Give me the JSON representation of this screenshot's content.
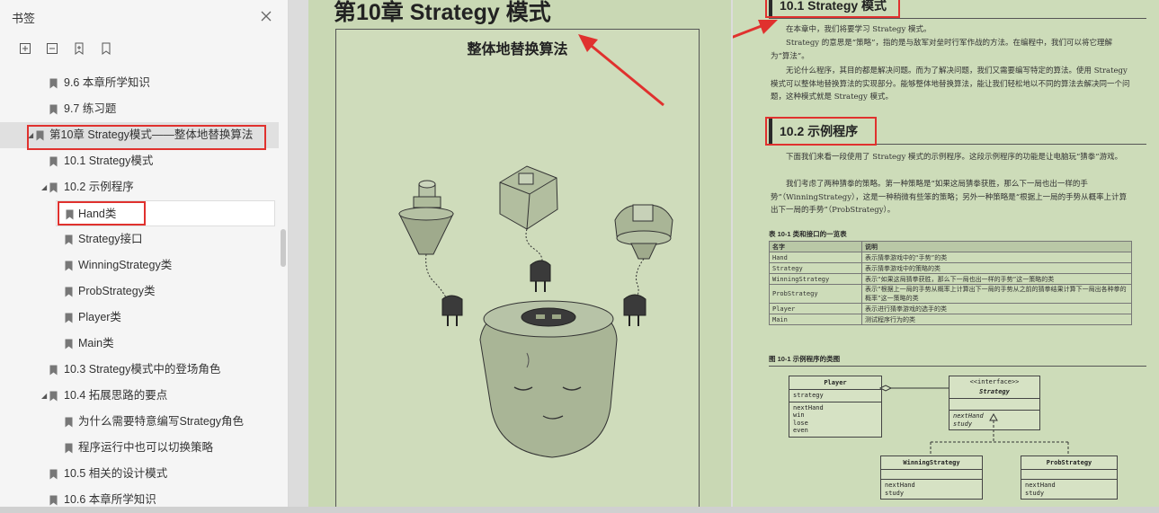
{
  "sidebar": {
    "title": "书签",
    "close_icon": "close-icon",
    "tools": [
      "expand-all-icon",
      "collapse-all-icon",
      "add-bookmark-icon",
      "bookmark-icon"
    ],
    "items": [
      {
        "label": "9.6 本章所学知识"
      },
      {
        "label": "9.7 练习题"
      },
      {
        "label": "第10章 Strategy模式——整体地替换算法",
        "expanded": true
      },
      {
        "label": "10.1 Strategy模式"
      },
      {
        "label": "10.2 示例程序",
        "expanded": true
      },
      {
        "label": "Hand类",
        "selected": true
      },
      {
        "label": "Strategy接口"
      },
      {
        "label": "WinningStrategy类"
      },
      {
        "label": "ProbStrategy类"
      },
      {
        "label": "Player类"
      },
      {
        "label": "Main类"
      },
      {
        "label": "10.3 Strategy模式中的登场角色"
      },
      {
        "label": "10.4 拓展思路的要点",
        "expanded": true
      },
      {
        "label": "为什么需要特意编写Strategy角色"
      },
      {
        "label": "程序运行中也可以切换策略"
      },
      {
        "label": "10.5 相关的设计模式"
      },
      {
        "label": "10.6 本章所学知识"
      }
    ]
  },
  "left_page": {
    "chapter_title": "第10章   Strategy 模式",
    "illustration_title": "整体地替换算法"
  },
  "right_page": {
    "sec1_title": "10.1   Strategy 模式",
    "sec1_paras": [
      "在本章中，我们将要学习 Strategy 模式。",
      "Strategy 的意思是“策略”，指的是与敌军对垒时行军作战的方法。在编程中，我们可以将它理解为“算法”。",
      "无论什么程序，其目的都是解决问题。而为了解决问题，我们又需要编写特定的算法。使用 Strategy 模式可以整体地替换算法的实现部分。能够整体地替换算法，能让我们轻松地以不同的算法去解决同一个问题，这种模式就是 Strategy 模式。"
    ],
    "sec2_title": "10.2   示例程序",
    "sec2_paras": [
      "下面我们来看一段使用了 Strategy 模式的示例程序。这段示例程序的功能是让电脑玩“猜拳”游戏。",
      "我们考虑了两种猜拳的策略。第一种策略是“如果这局猜拳获胜，那么下一局也出一样的手势”（WinningStrategy），这是一种稍微有些笨的策略；另外一种策略是“根据上一局的手势从概率上计算出下一局的手势”（ProbStrategy）。"
    ],
    "table_caption": "表 10-1   类和接口的一览表",
    "table_headers": [
      "名字",
      "说明"
    ],
    "table_rows": [
      [
        "Hand",
        "表示猜拳游戏中的“手势”的类"
      ],
      [
        "Strategy",
        "表示猜拳游戏中的策略的类"
      ],
      [
        "WinningStrategy",
        "表示“如果这局猜拳获胜，那么下一局也出一样的手势”这一策略的类"
      ],
      [
        "ProbStrategy",
        "表示“根据上一局的手势从概率上计算出下一局的手势从之前的猜拳结果计算下一局出各种拳的概率”这一策略的类"
      ],
      [
        "Player",
        "表示进行猜拳游戏的选手的类"
      ],
      [
        "Main",
        "测试程序行为的类"
      ]
    ],
    "figure_caption": "图 10-1   示例程序的类图",
    "uml": {
      "player": {
        "name": "Player",
        "fields": "strategy",
        "methods": [
          "nextHand",
          "win",
          "lose",
          "even"
        ]
      },
      "strategy": {
        "stereotype": "<<interface>>",
        "name": "Strategy",
        "methods": [
          "nextHand",
          "study"
        ]
      },
      "winning": {
        "name": "WinningStrategy",
        "methods": [
          "nextHand",
          "study"
        ]
      },
      "prob": {
        "name": "ProbStrategy",
        "methods": [
          "nextHand",
          "study"
        ]
      }
    }
  },
  "colors": {
    "annotation_red": "#e0312e",
    "page_bg": "#c9d8b4"
  }
}
